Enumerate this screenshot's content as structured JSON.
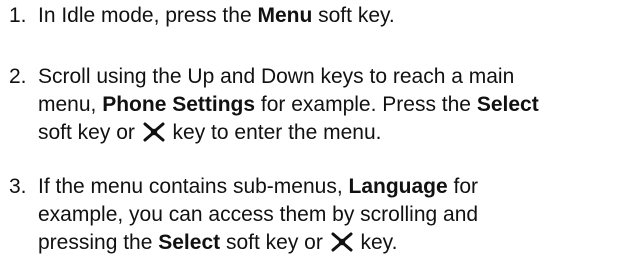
{
  "steps": [
    {
      "number": "1.",
      "lines": [
        {
          "t1": "In Idle mode, press the ",
          "b1": "Menu",
          "t2": " soft key."
        }
      ]
    },
    {
      "number": "2.",
      "lines": [
        {
          "t1": "Scroll using the Up and Down keys to reach a main"
        },
        {
          "t1": "menu, ",
          "b1": "Phone Settings",
          "t2": " for example. Press the ",
          "b2": "Select"
        },
        {
          "t1": "soft key or ",
          "t2": " key to enter the menu."
        }
      ]
    },
    {
      "number": "3.",
      "lines": [
        {
          "t1": "If the menu contains sub-menus, ",
          "b1": "Language",
          "t2": " for"
        },
        {
          "t1": "example, you can access them by scrolling and"
        },
        {
          "t1": "pressing the ",
          "b1": "Select",
          "t2": " soft key or ",
          "t3": " key."
        }
      ]
    }
  ],
  "icons": {
    "center_key": "center-key-icon"
  }
}
